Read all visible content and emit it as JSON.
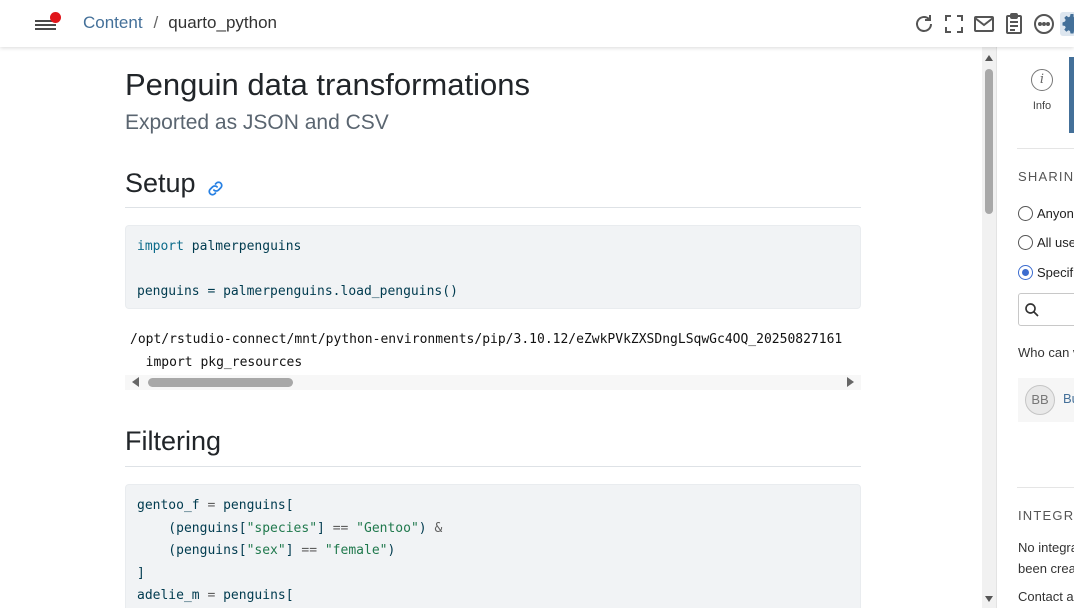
{
  "breadcrumb": {
    "root": "Content",
    "separator": "/",
    "current": "quarto_python"
  },
  "toolbar": {
    "icons": [
      "refresh-icon",
      "fullscreen-icon",
      "email-icon",
      "clipboard-icon",
      "more-icon",
      "settings-icon"
    ]
  },
  "document": {
    "title": "Penguin data transformations",
    "subtitle": "Exported as JSON and CSV",
    "sections": [
      {
        "heading": "Setup",
        "code": [
          "import palmerpenguins",
          "",
          "penguins = palmerpenguins.load_penguins()"
        ],
        "output": [
          "/opt/rstudio-connect/mnt/python-environments/pip/3.10.12/eZwkPVkZXSDngLSqwGc4OQ_20250827161",
          "  import pkg_resources"
        ]
      },
      {
        "heading": "Filtering",
        "code": [
          "gentoo_f = penguins[",
          "    (penguins[\"species\"] == \"Gentoo\") &",
          "    (penguins[\"sex\"] == \"female\")",
          "]",
          "adelie_m = penguins["
        ]
      }
    ]
  },
  "panel": {
    "info_label": "Info",
    "sharing_heading": "SHARING",
    "access_options": [
      "Anyone",
      "All users",
      "Specific"
    ],
    "selected_access": "Specific",
    "who_can_view": "Who can v",
    "user_initials": "BB",
    "user_name": "Bu",
    "integrations_heading": "INTEGRA",
    "integrations_text": [
      "No integra",
      "been creat"
    ],
    "contact_text": "Contact ar"
  },
  "colors": {
    "accent": "#447099",
    "notification": "#e0151b",
    "radio_selected": "#3c6ccf"
  }
}
